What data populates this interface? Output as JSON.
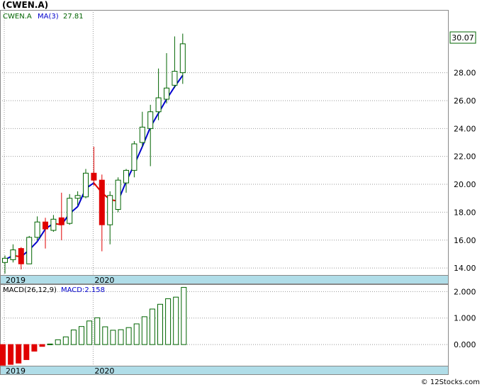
{
  "title": "(CWEN.A)",
  "watermark": "© 12Stocks.com",
  "colors": {
    "up_body": "#ffffff",
    "up_edge": "#006400",
    "down_body": "#e00000",
    "ma_up": "#0000cc",
    "ma_down": "#e00000",
    "macd_bar": "#006400",
    "macd_neg": "#e00000",
    "axis_strip": "#b0dde8",
    "grid": "#999999"
  },
  "chart_data": [
    {
      "type": "candlestick",
      "legend": {
        "symbol": "CWEN.A",
        "ma_label": "MA(3)",
        "ma_value": "27.81"
      },
      "ylim": [
        13.5,
        32.5
      ],
      "yticks": [
        "14.00",
        "16.00",
        "18.00",
        "20.00",
        "22.00",
        "24.00",
        "26.00",
        "28.00"
      ],
      "last_price": "30.07",
      "x_labels": [
        {
          "label": "2019",
          "index": 0
        },
        {
          "label": "2020",
          "index": 11
        }
      ],
      "grid": true,
      "candles": [
        {
          "o": 14.4,
          "h": 14.9,
          "l": 13.6,
          "c": 14.7
        },
        {
          "o": 14.6,
          "h": 15.7,
          "l": 14.4,
          "c": 15.3
        },
        {
          "o": 15.4,
          "h": 15.5,
          "l": 13.9,
          "c": 14.3
        },
        {
          "o": 14.3,
          "h": 16.3,
          "l": 14.3,
          "c": 16.2
        },
        {
          "o": 16.2,
          "h": 17.7,
          "l": 16.0,
          "c": 17.3
        },
        {
          "o": 17.3,
          "h": 17.6,
          "l": 15.4,
          "c": 16.8
        },
        {
          "o": 16.7,
          "h": 17.8,
          "l": 16.6,
          "c": 17.5
        },
        {
          "o": 17.6,
          "h": 19.4,
          "l": 16.0,
          "c": 17.1
        },
        {
          "o": 17.2,
          "h": 19.3,
          "l": 17.1,
          "c": 19.0
        },
        {
          "o": 19.0,
          "h": 19.5,
          "l": 18.5,
          "c": 19.2
        },
        {
          "o": 19.1,
          "h": 21.1,
          "l": 19.0,
          "c": 20.8
        },
        {
          "o": 20.8,
          "h": 22.7,
          "l": 19.9,
          "c": 20.3
        },
        {
          "o": 20.3,
          "h": 20.7,
          "l": 15.2,
          "c": 17.1
        },
        {
          "o": 17.1,
          "h": 19.5,
          "l": 15.7,
          "c": 19.2
        },
        {
          "o": 18.2,
          "h": 20.5,
          "l": 18.0,
          "c": 20.3
        },
        {
          "o": 20.1,
          "h": 21.1,
          "l": 19.4,
          "c": 21.0
        },
        {
          "o": 21.0,
          "h": 23.1,
          "l": 20.5,
          "c": 22.9
        },
        {
          "o": 23.0,
          "h": 25.2,
          "l": 22.7,
          "c": 24.1
        },
        {
          "o": 24.0,
          "h": 25.7,
          "l": 21.3,
          "c": 25.2
        },
        {
          "o": 25.2,
          "h": 28.3,
          "l": 24.6,
          "c": 26.2
        },
        {
          "o": 26.1,
          "h": 29.4,
          "l": 25.8,
          "c": 26.9
        },
        {
          "o": 27.1,
          "h": 30.6,
          "l": 26.9,
          "c": 28.1
        },
        {
          "o": 28.0,
          "h": 30.8,
          "l": 27.2,
          "c": 30.07
        }
      ],
      "ma": [
        14.6,
        14.9,
        14.8,
        15.3,
        15.9,
        16.8,
        17.2,
        17.1,
        17.9,
        18.4,
        19.7,
        20.1,
        19.4,
        18.9,
        18.8,
        20.2,
        21.4,
        22.7,
        24.1,
        25.1,
        26.1,
        27.0,
        27.81
      ]
    },
    {
      "type": "bar",
      "legend": {
        "label": "MACD(26,12,9)",
        "value_label": "MACD:2.158"
      },
      "ylim": [
        -0.8,
        2.25
      ],
      "yticks": [
        "0.000",
        "1.000",
        "2.000"
      ],
      "x_labels": [
        {
          "label": "2019",
          "index": 0
        },
        {
          "label": "2020",
          "index": 11
        }
      ],
      "values": [
        -0.78,
        -0.75,
        -0.7,
        -0.57,
        -0.25,
        -0.07,
        0.02,
        0.18,
        0.29,
        0.55,
        0.68,
        0.89,
        1.01,
        0.67,
        0.54,
        0.56,
        0.64,
        0.78,
        1.05,
        1.34,
        1.52,
        1.73,
        1.79,
        2.158
      ]
    }
  ]
}
